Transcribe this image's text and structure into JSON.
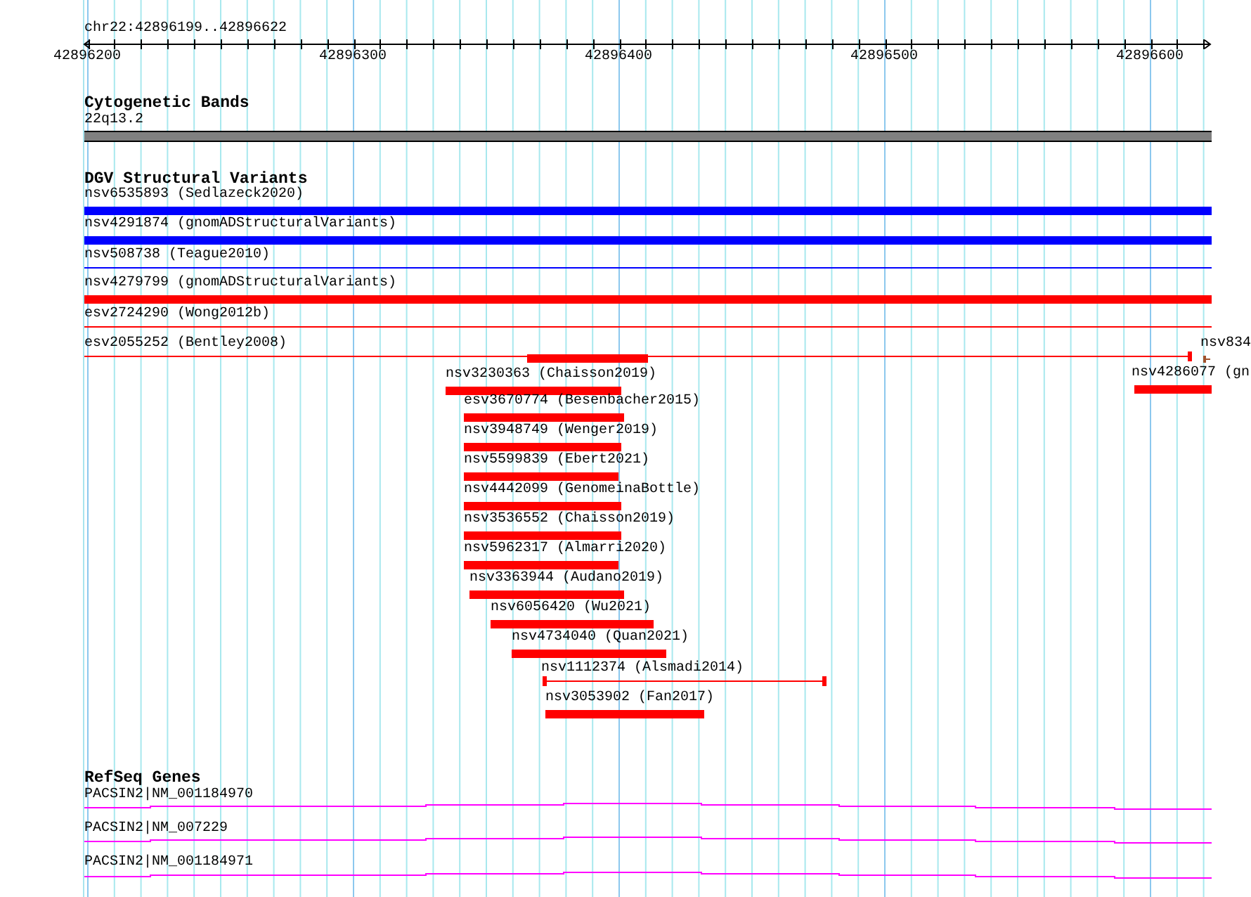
{
  "location": "chr22:42896199..42896622",
  "ruler": {
    "ticks": [
      "42896200",
      "42896300",
      "42896400",
      "42896500",
      "42896600"
    ]
  },
  "tracks": [
    {
      "title": "Cytogenetic Bands",
      "kind": "cytoband",
      "features": [
        {
          "label": "22q13.2",
          "color": "#808080"
        }
      ]
    },
    {
      "title": "DGV Structural Variants",
      "kind": "variants",
      "features": [
        {
          "label": "nsv6535893 (Sedlazeck2020)",
          "kind": "bar",
          "color": "#0000ff"
        },
        {
          "label": "nsv4291874 (gnomADStructuralVariants)",
          "kind": "bar",
          "color": "#0000ff"
        },
        {
          "label": "nsv508738 (Teague2010)",
          "kind": "line",
          "color": "#0000ff"
        },
        {
          "label": "nsv4279799 (gnomADStructuralVariants)",
          "kind": "bar",
          "color": "#ff0000"
        },
        {
          "label": "esv2724290 (Wong2012b)",
          "kind": "line",
          "color": "#ff0000"
        },
        {
          "label": "esv2055252 (Bentley2008)",
          "kind": "capped-line",
          "color": "#ff0000"
        },
        {
          "label": "nsv834",
          "kind": "marker",
          "color": "#a0522d"
        },
        {
          "kind": "bar",
          "color": "#ff0000"
        },
        {
          "label": "nsv3230363 (Chaisson2019)",
          "kind": "bar",
          "color": "#ff0000"
        },
        {
          "label": "nsv4286077 (gn",
          "kind": "bar",
          "color": "#ff0000"
        },
        {
          "label": "esv3670774 (Besenbacher2015)",
          "kind": "bar",
          "color": "#ff0000"
        },
        {
          "label": "nsv3948749 (Wenger2019)",
          "kind": "bar",
          "color": "#ff0000"
        },
        {
          "label": "nsv5599839 (Ebert2021)",
          "kind": "bar",
          "color": "#ff0000"
        },
        {
          "label": "nsv4442099 (GenomeinaBottle)",
          "kind": "bar",
          "color": "#ff0000"
        },
        {
          "label": "nsv3536552 (Chaisson2019)",
          "kind": "bar",
          "color": "#ff0000"
        },
        {
          "label": "nsv5962317 (Almarri2020)",
          "kind": "bar",
          "color": "#ff0000"
        },
        {
          "label": "nsv3363944 (Audano2019)",
          "kind": "bar",
          "color": "#ff0000"
        },
        {
          "label": "nsv6056420 (Wu2021)",
          "kind": "bar",
          "color": "#ff0000"
        },
        {
          "label": "nsv4734040 (Quan2021)",
          "kind": "bar",
          "color": "#ff0000"
        },
        {
          "label": "nsv1112374 (Alsmadi2014)",
          "kind": "capped-line",
          "color": "#ff0000"
        },
        {
          "label": "nsv3053902 (Fan2017)",
          "kind": "bar",
          "color": "#ff0000"
        }
      ]
    },
    {
      "title": "RefSeq Genes",
      "kind": "genes",
      "features": [
        {
          "label": "PACSIN2|NM_001184970",
          "color": "#ff00ff"
        },
        {
          "label": "PACSIN2|NM_007229",
          "color": "#ff00ff"
        },
        {
          "label": "PACSIN2|NM_001184971",
          "color": "#ff00ff"
        }
      ]
    }
  ]
}
